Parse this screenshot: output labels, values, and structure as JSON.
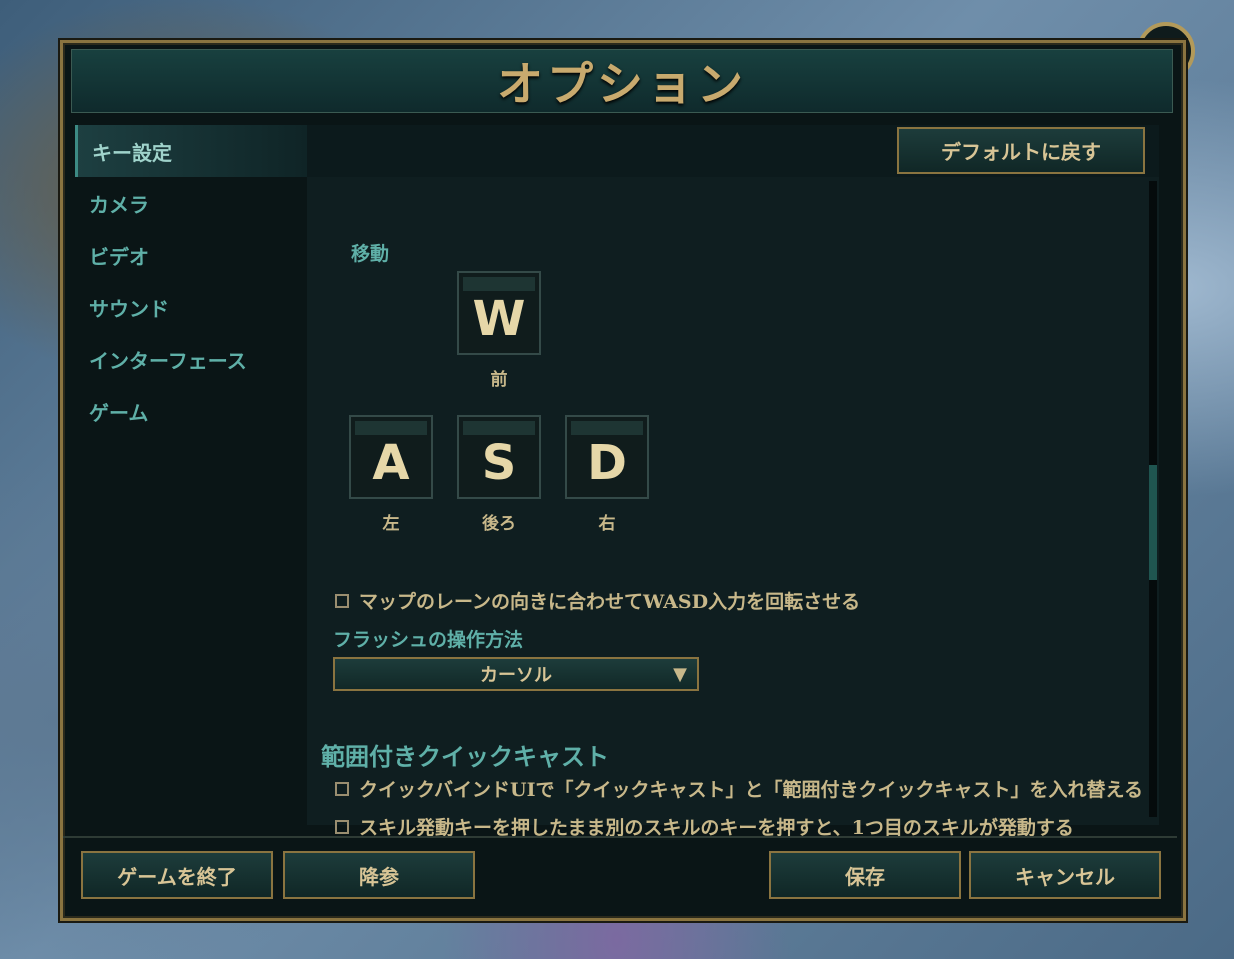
{
  "window": {
    "title": "オプション",
    "close_glyph": "✕"
  },
  "sidebar": {
    "items": [
      {
        "label": "キー設定",
        "active": true
      },
      {
        "label": "カメラ"
      },
      {
        "label": "ビデオ"
      },
      {
        "label": "サウンド"
      },
      {
        "label": "インターフェース"
      },
      {
        "label": "ゲーム"
      }
    ]
  },
  "toolbar": {
    "reset_label": "デフォルトに戻す"
  },
  "movement": {
    "section_label": "移動",
    "keys": {
      "w": {
        "key": "W",
        "label": "前"
      },
      "a": {
        "key": "A",
        "label": "左"
      },
      "s": {
        "key": "S",
        "label": "後ろ"
      },
      "d": {
        "key": "D",
        "label": "右"
      }
    },
    "rotate_wasd_option": "マップのレーンの向きに合わせてWASD入力を回転させる"
  },
  "flash": {
    "label": "フラッシュの操作方法",
    "selected": "カーソル",
    "arrow": "▼"
  },
  "quickcast": {
    "heading": "範囲付きクイックキャスト",
    "option1": "クイックバインドUIで「クイックキャスト」と「範囲付きクイックキャスト」を入れ替える",
    "option2": "スキル発動キーを押したまま別のスキルのキーを押すと、1つ目のスキルが発動する"
  },
  "footer": {
    "quit_label": "ゲームを終了",
    "surrender_label": "降参",
    "save_label": "保存",
    "cancel_label": "キャンセル"
  },
  "colors": {
    "gold": "#c8aa6e",
    "teal_text": "#5fb0a8",
    "panel_bg": "#0a1516"
  }
}
